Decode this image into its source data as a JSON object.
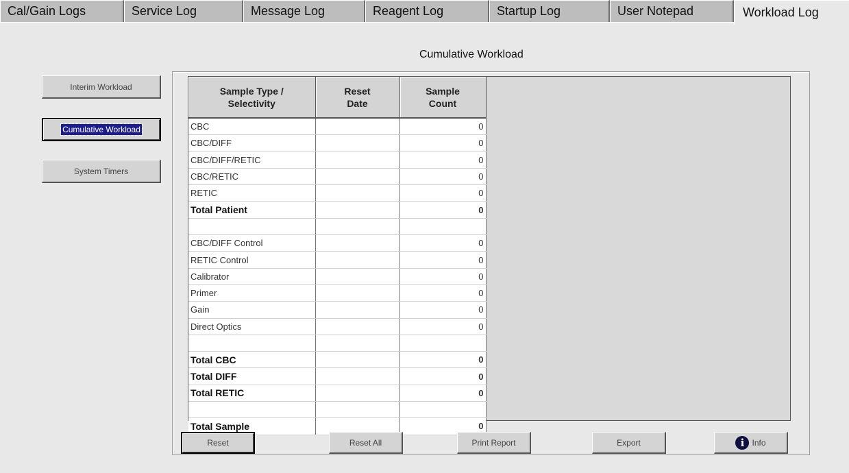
{
  "tabs": [
    {
      "label": "Cal/Gain Logs"
    },
    {
      "label": "Service Log"
    },
    {
      "label": "Message Log"
    },
    {
      "label": "Reagent Log"
    },
    {
      "label": "Startup Log"
    },
    {
      "label": "User Notepad"
    },
    {
      "label": "Workload Log"
    }
  ],
  "view_title": "Cumulative Workload",
  "side_buttons": {
    "interim": "Interim Workload",
    "cumulative": "Cumulative Workload",
    "timers": "System Timers"
  },
  "table": {
    "headers": {
      "type": "Sample Type /\nSelectivity",
      "reset_date": "Reset\nDate",
      "count": "Sample\nCount"
    },
    "rows": [
      {
        "type": "CBC",
        "date": "",
        "count": "0"
      },
      {
        "type": "CBC/DIFF",
        "date": "",
        "count": "0"
      },
      {
        "type": "CBC/DIFF/RETIC",
        "date": "",
        "count": "0"
      },
      {
        "type": "CBC/RETIC",
        "date": "",
        "count": "0"
      },
      {
        "type": "RETIC",
        "date": "",
        "count": "0"
      },
      {
        "type": "Total Patient",
        "date": "",
        "count": "0"
      },
      {
        "type": "",
        "date": "",
        "count": ""
      },
      {
        "type": "CBC/DIFF Control",
        "date": "",
        "count": "0"
      },
      {
        "type": "RETIC Control",
        "date": "",
        "count": "0"
      },
      {
        "type": "Calibrator",
        "date": "",
        "count": "0"
      },
      {
        "type": "Primer",
        "date": "",
        "count": "0"
      },
      {
        "type": "Gain",
        "date": "",
        "count": "0"
      },
      {
        "type": "Direct Optics",
        "date": "",
        "count": "0"
      },
      {
        "type": "",
        "date": "",
        "count": ""
      },
      {
        "type": "Total CBC",
        "date": "",
        "count": "0"
      },
      {
        "type": "Total DIFF",
        "date": "",
        "count": "0"
      },
      {
        "type": "Total RETIC",
        "date": "",
        "count": "0"
      },
      {
        "type": "",
        "date": "",
        "count": ""
      },
      {
        "type": "Total Sample",
        "date": "",
        "count": "0"
      }
    ]
  },
  "bottom_buttons": {
    "reset": "Reset",
    "reset_all": "Reset All",
    "print_report": "Print Report",
    "export": "Export",
    "info": "Info"
  },
  "icons": {
    "info": "info-circle-icon"
  }
}
